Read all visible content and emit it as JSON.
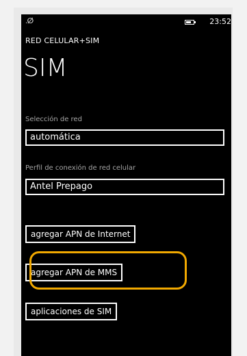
{
  "statusbar": {
    "signal": ".ⵁ",
    "time": "23:52",
    "battery_icon": "battery-icon"
  },
  "app_title": "RED CELULAR+SIM",
  "page_title": "SIM",
  "network_selection": {
    "label": "Selección de red",
    "value": "automática"
  },
  "connection_profile": {
    "label": "Perfil de conexión de red celular",
    "value": "Antel Prepago"
  },
  "buttons": {
    "add_internet_apn": "agregar APN de Internet",
    "add_mms_apn": "agregar APN de MMS",
    "sim_apps": "aplicaciones de SIM"
  },
  "highlight_color": "#f2a900"
}
